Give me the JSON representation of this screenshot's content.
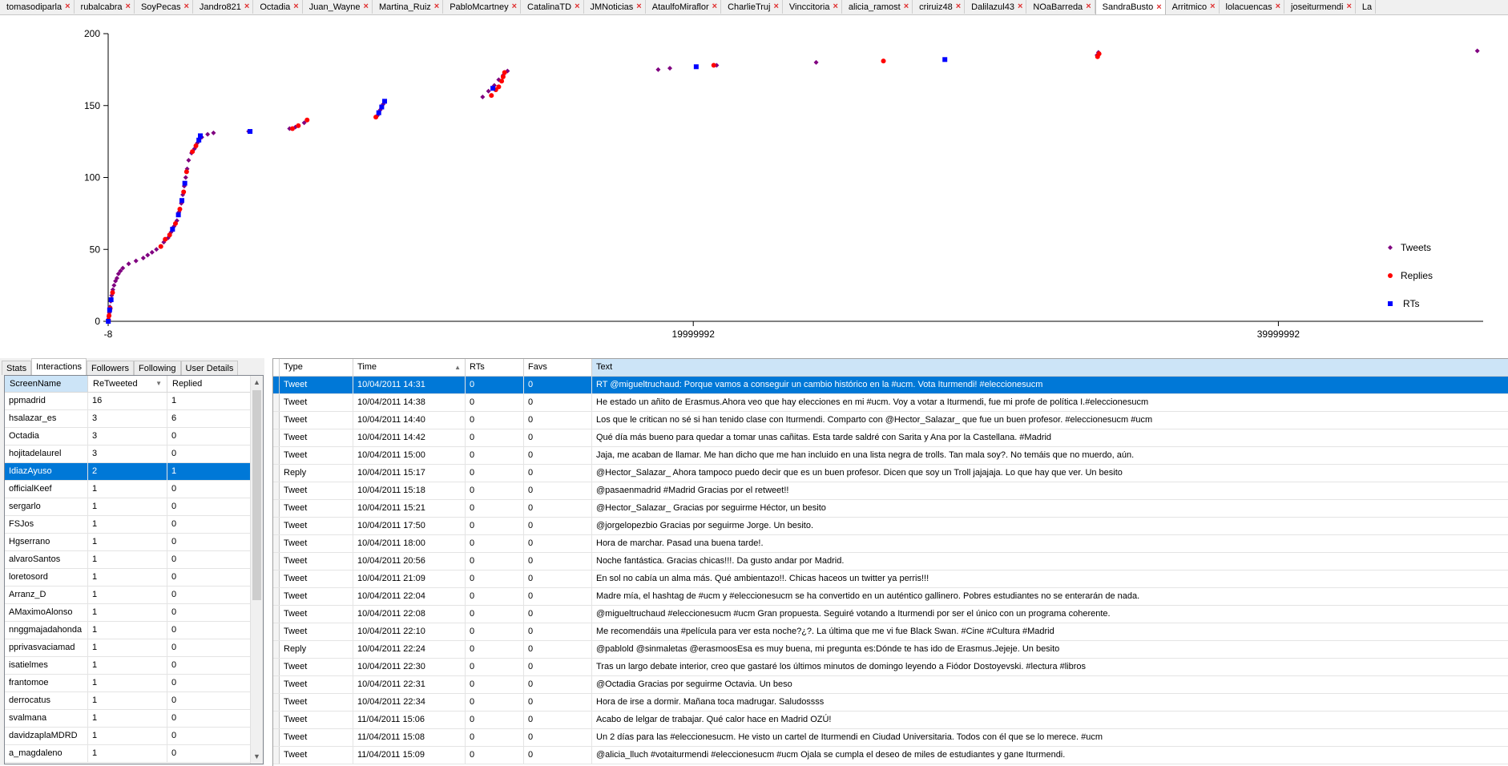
{
  "tabs": [
    "tomasodiparla",
    "rubalcabra",
    "SoyPecas",
    "Jandro821",
    "Octadia",
    "Juan_Wayne",
    "Martina_Ruiz",
    "PabloMcartney",
    "CatalinaTD",
    "JMNoticias",
    "AtaulfoMiraflor",
    "CharlieTruj",
    "Vinccitoria",
    "alicia_ramost",
    "criruiz48",
    "Dalilazul43",
    "NOaBarreda",
    "SandraBusto",
    "Arritmico",
    "lolacuencas",
    "joseiturmendi",
    "La"
  ],
  "active_tab": 17,
  "chart_data": {
    "type": "scatter",
    "title": "",
    "xlabel": "",
    "ylabel": "",
    "xlim": [
      -8,
      47000000
    ],
    "ylim": [
      0,
      200
    ],
    "x_ticks": [
      "-8",
      "19999992",
      "39999992"
    ],
    "x_tick_values": [
      -8,
      19999992,
      39999992
    ],
    "y_ticks": [
      "0",
      "50",
      "100",
      "150",
      "200"
    ],
    "y_tick_values": [
      0,
      50,
      100,
      150,
      200
    ],
    "legend_position": "right",
    "series": [
      {
        "name": "Tweets",
        "color": "#800080",
        "marker": "diamond",
        "points": [
          [
            0,
            0
          ],
          [
            20000,
            3
          ],
          [
            40000,
            6
          ],
          [
            60000,
            10
          ],
          [
            90000,
            14
          ],
          [
            120000,
            18
          ],
          [
            160000,
            22
          ],
          [
            200000,
            25
          ],
          [
            250000,
            28
          ],
          [
            300000,
            30
          ],
          [
            350000,
            33
          ],
          [
            420000,
            35
          ],
          [
            500000,
            37
          ],
          [
            700000,
            40
          ],
          [
            950000,
            42
          ],
          [
            1200000,
            44
          ],
          [
            1350000,
            46
          ],
          [
            1500000,
            48
          ],
          [
            1650000,
            50
          ],
          [
            1900000,
            55
          ],
          [
            2050000,
            58
          ],
          [
            2150000,
            62
          ],
          [
            2250000,
            66
          ],
          [
            2350000,
            70
          ],
          [
            2420000,
            76
          ],
          [
            2500000,
            82
          ],
          [
            2550000,
            88
          ],
          [
            2600000,
            94
          ],
          [
            2650000,
            100
          ],
          [
            2700000,
            106
          ],
          [
            2750000,
            112
          ],
          [
            2850000,
            117
          ],
          [
            2950000,
            120
          ],
          [
            3050000,
            124
          ],
          [
            3200000,
            128
          ],
          [
            3400000,
            130
          ],
          [
            3600000,
            131
          ],
          [
            4800000,
            132
          ],
          [
            6200000,
            134
          ],
          [
            6400000,
            135
          ],
          [
            6700000,
            138
          ],
          [
            9200000,
            143
          ],
          [
            9300000,
            147
          ],
          [
            9400000,
            151
          ],
          [
            12800000,
            156
          ],
          [
            13000000,
            160
          ],
          [
            13200000,
            164
          ],
          [
            13350000,
            168
          ],
          [
            13500000,
            171
          ],
          [
            13650000,
            174
          ],
          [
            18800000,
            175
          ],
          [
            19200000,
            176
          ],
          [
            20800000,
            178
          ],
          [
            24200000,
            180
          ],
          [
            33800000,
            185
          ],
          [
            33850000,
            187
          ],
          [
            46800000,
            188
          ]
        ]
      },
      {
        "name": "Replies",
        "color": "#ff0000",
        "marker": "circle",
        "points": [
          [
            10000,
            1
          ],
          [
            30000,
            4
          ],
          [
            70000,
            9
          ],
          [
            150000,
            20
          ],
          [
            1800000,
            52
          ],
          [
            1950000,
            57
          ],
          [
            2100000,
            60
          ],
          [
            2300000,
            68
          ],
          [
            2450000,
            78
          ],
          [
            2580000,
            90
          ],
          [
            2680000,
            104
          ],
          [
            2880000,
            118
          ],
          [
            3000000,
            122
          ],
          [
            6300000,
            134
          ],
          [
            6500000,
            136
          ],
          [
            6800000,
            140
          ],
          [
            9150000,
            142
          ],
          [
            13100000,
            157
          ],
          [
            13250000,
            161
          ],
          [
            13350000,
            163
          ],
          [
            13450000,
            167
          ],
          [
            13500000,
            170
          ],
          [
            13550000,
            173
          ],
          [
            20700000,
            178
          ],
          [
            26500000,
            181
          ],
          [
            33820000,
            184
          ],
          [
            33870000,
            186
          ]
        ]
      },
      {
        "name": "RTs",
        "color": "#0000ff",
        "marker": "square",
        "points": [
          [
            5000,
            0
          ],
          [
            50000,
            8
          ],
          [
            100000,
            15
          ],
          [
            2200000,
            64
          ],
          [
            2400000,
            74
          ],
          [
            2520000,
            84
          ],
          [
            2620000,
            96
          ],
          [
            3100000,
            126
          ],
          [
            3150000,
            129
          ],
          [
            4850000,
            132
          ],
          [
            9250000,
            145
          ],
          [
            9350000,
            149
          ],
          [
            9450000,
            153
          ],
          [
            13150000,
            162
          ],
          [
            20100000,
            177
          ],
          [
            28600000,
            182
          ]
        ]
      }
    ]
  },
  "left_tabs": [
    "Stats",
    "Interactions",
    "Followers",
    "Following",
    "User Details"
  ],
  "left_active_tab": 1,
  "interactions": {
    "columns": [
      "ScreenName",
      "ReTweeted",
      "Replied"
    ],
    "sorted_column": 1,
    "selected_row": 4,
    "rows": [
      [
        "ppmadrid",
        "16",
        "1"
      ],
      [
        "hsalazar_es",
        "3",
        "6"
      ],
      [
        "Octadia",
        "3",
        "0"
      ],
      [
        "hojitadelaurel",
        "3",
        "0"
      ],
      [
        "IdiazAyuso",
        "2",
        "1"
      ],
      [
        "officialKeef",
        "1",
        "0"
      ],
      [
        "sergarlo",
        "1",
        "0"
      ],
      [
        "FSJos",
        "1",
        "0"
      ],
      [
        "Hgserrano",
        "1",
        "0"
      ],
      [
        "alvaroSantos",
        "1",
        "0"
      ],
      [
        "loretosord",
        "1",
        "0"
      ],
      [
        "Arranz_D",
        "1",
        "0"
      ],
      [
        "AMaximoAlonso",
        "1",
        "0"
      ],
      [
        "nnggmajadahonda",
        "1",
        "0"
      ],
      [
        "pprivasvaciamad",
        "1",
        "0"
      ],
      [
        "isatielmes",
        "1",
        "0"
      ],
      [
        "frantomoe",
        "1",
        "0"
      ],
      [
        "derrocatus",
        "1",
        "0"
      ],
      [
        "svalmana",
        "1",
        "0"
      ],
      [
        "davidzaplaMDRD",
        "1",
        "0"
      ],
      [
        "a_magdaleno",
        "1",
        "0"
      ]
    ]
  },
  "tweets": {
    "columns": [
      "Type",
      "Time",
      "RTs",
      "Favs",
      "Text"
    ],
    "sorted_column": 1,
    "selected_row": 0,
    "rows": [
      [
        "Tweet",
        "10/04/2011 14:31",
        "0",
        "0",
        "RT @migueltruchaud: Porque vamos a conseguir un cambio histórico en la #ucm. Vota Iturmendi! #eleccionesucm"
      ],
      [
        "Tweet",
        "10/04/2011 14:38",
        "0",
        "0",
        "He estado un añito de Erasmus.Ahora veo que hay elecciones en mi #ucm. Voy a votar a Iturmendi, fue mi profe de política I.#eleccionesucm"
      ],
      [
        "Tweet",
        "10/04/2011 14:40",
        "0",
        "0",
        "Los que le critican no sé si han tenido clase con Iturmendi. Comparto con @Hector_Salazar_  que fue un buen profesor. #eleccionesucm #ucm"
      ],
      [
        "Tweet",
        "10/04/2011 14:42",
        "0",
        "0",
        "Qué día más bueno para quedar a tomar unas cañitas. Esta tarde saldré con Sarita y Ana por la Castellana. #Madrid"
      ],
      [
        "Tweet",
        "10/04/2011 15:00",
        "0",
        "0",
        "Jaja, me acaban de llamar. Me han dicho que me han incluido en una lista negra de trolls. Tan mala soy?. No temáis que no muerdo, aún."
      ],
      [
        "Reply",
        "10/04/2011 15:17",
        "0",
        "0",
        "@Hector_Salazar_  Ahora tampoco puedo decir que es un buen profesor. Dicen que soy un Troll jajajaja. Lo que hay que ver. Un besito"
      ],
      [
        "Tweet",
        "10/04/2011 15:18",
        "0",
        "0",
        "@pasaenmadrid  #Madrid Gracias por el retweet!!"
      ],
      [
        "Tweet",
        "10/04/2011 15:21",
        "0",
        "0",
        "@Hector_Salazar_ Gracias por seguirme Héctor, un besito"
      ],
      [
        "Tweet",
        "10/04/2011 17:50",
        "0",
        "0",
        "@jorgelopezbio Gracias por seguirme Jorge. Un besito."
      ],
      [
        "Tweet",
        "10/04/2011 18:00",
        "0",
        "0",
        "Hora de marchar. Pasad una buena tarde!."
      ],
      [
        "Tweet",
        "10/04/2011 20:56",
        "0",
        "0",
        "Noche fantástica. Gracias chicas!!!. Da gusto andar por Madrid."
      ],
      [
        "Tweet",
        "10/04/2011 21:09",
        "0",
        "0",
        "En sol no cabía un alma más. Qué ambientazo!!. Chicas haceos un twitter ya perris!!!"
      ],
      [
        "Tweet",
        "10/04/2011 22:04",
        "0",
        "0",
        "Madre mía, el hashtag de #ucm y #eleccionesucm se ha convertido en un auténtico gallinero. Pobres estudiantes no se enterarán de nada."
      ],
      [
        "Tweet",
        "10/04/2011 22:08",
        "0",
        "0",
        "@migueltruchaud  #eleccionesucm #ucm Gran propuesta. Seguiré votando a Iturmendi por ser el único con un programa coherente."
      ],
      [
        "Tweet",
        "10/04/2011 22:10",
        "0",
        "0",
        "Me recomendáis una #película para ver esta noche?¿?. La última que me vi fue Black Swan. #Cine #Cultura #Madrid"
      ],
      [
        "Reply",
        "10/04/2011 22:24",
        "0",
        "0",
        "@pablold @sinmaletas @erasmoosEsa es muy buena, mi pregunta es:Dónde te has ido de Erasmus.Jejeje. Un besito"
      ],
      [
        "Tweet",
        "10/04/2011 22:30",
        "0",
        "0",
        "Tras un largo debate interior, creo que gastaré los últimos minutos de domingo leyendo a Fiódor Dostoyevski. #lectura #libros"
      ],
      [
        "Tweet",
        "10/04/2011 22:31",
        "0",
        "0",
        "@Octadia Gracias por seguirme Octavia. Un beso"
      ],
      [
        "Tweet",
        "10/04/2011 22:34",
        "0",
        "0",
        "Hora de irse a dormir. Mañana toca madrugar. Saludossss"
      ],
      [
        "Tweet",
        "11/04/2011 15:06",
        "0",
        "0",
        "Acabo de lelgar de trabajar. Qué calor hace en Madrid OZÚ!"
      ],
      [
        "Tweet",
        "11/04/2011 15:08",
        "0",
        "0",
        "Un 2 días para las #eleccionesucm. He visto un cartel de Iturmendi en Ciudad Universitaria. Todos con él que se lo merece. #ucm"
      ],
      [
        "Tweet",
        "11/04/2011 15:09",
        "0",
        "0",
        "@alicia_lluch  #votaiturmendi #eleccionesucm #ucm Ojala se cumpla el deseo de miles de estudiantes y gane Iturmendi."
      ]
    ]
  }
}
